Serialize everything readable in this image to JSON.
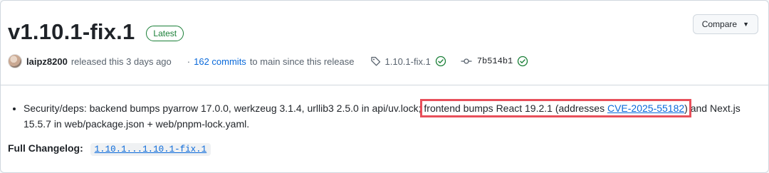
{
  "release": {
    "title": "v1.10.1-fix.1",
    "badge": "Latest",
    "compare_label": "Compare"
  },
  "meta": {
    "author": "laipz8200",
    "released_text": "released this 3 days ago",
    "dot": "·",
    "commits_link": "162 commits",
    "commits_suffix": "to main since this release",
    "tag": "1.10.1-fix.1",
    "commit_sha": "7b514b1"
  },
  "body": {
    "bullet_before": "Security/deps: backend bumps pyarrow 17.0.0, werkzeug 3.1.4, urllib3 2.5.0 in api/uv.lock; ",
    "bullet_highlight_text": "frontend bumps React 19.2.1 (addresses ",
    "cve_link": "CVE-2025-55182",
    "bullet_highlight_close": ")",
    "bullet_after": " and Next.js 15.5.7 in web/package.json + web/pnpm-lock.yaml.",
    "changelog_label": "Full Changelog:",
    "changelog_value": "1.10.1...1.10.1-fix.1"
  },
  "colors": {
    "accent_link": "#0969da",
    "success": "#1a7f37",
    "highlight_box": "#e8505b"
  }
}
